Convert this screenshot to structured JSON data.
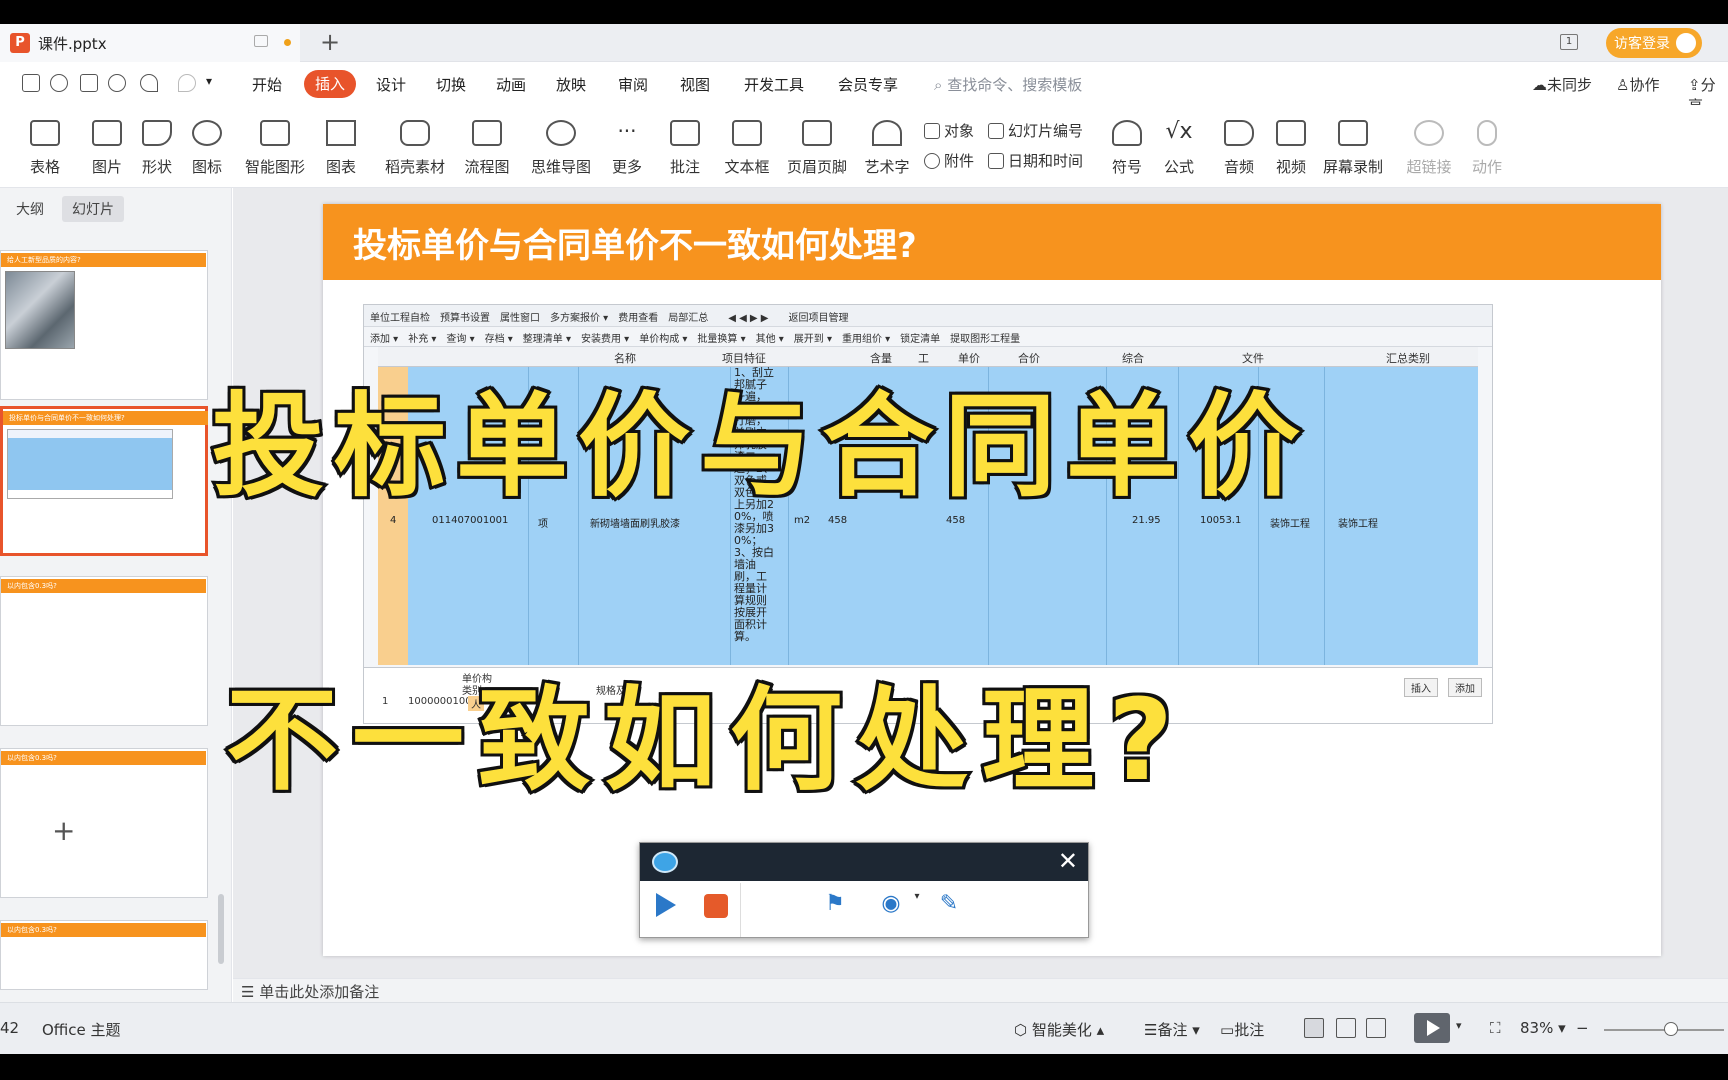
{
  "window": {
    "tab_title": "课件.pptx",
    "login_button": "访客登录",
    "new_tab": "+",
    "window_count": "1"
  },
  "menu": {
    "items": [
      "开始",
      "插入",
      "设计",
      "切换",
      "动画",
      "放映",
      "审阅",
      "视图",
      "开发工具",
      "会员专享"
    ],
    "active": "插入",
    "search_placeholder": "查找命令、搜索模板",
    "sync": "未同步",
    "collab": "协作",
    "share": "分享"
  },
  "ribbon": {
    "table": "表格",
    "picture": "图片",
    "shape": "形状",
    "icon": "图标",
    "smartart": "智能图形",
    "chart": "图表",
    "material": "稻壳素材",
    "flowchart": "流程图",
    "mindmap": "思维导图",
    "more": "更多",
    "comment": "批注",
    "textbox": "文本框",
    "header_footer": "页眉页脚",
    "wordart": "艺术字",
    "object": "对象",
    "slide_number": "幻灯片编号",
    "attachment": "附件",
    "datetime": "日期和时间",
    "symbol": "符号",
    "formula": "公式",
    "audio": "音频",
    "video": "视频",
    "screen_record": "屏幕录制",
    "hyperlink": "超链接",
    "action": "动作"
  },
  "left_pane": {
    "tab_outline": "大纲",
    "tab_slides": "幻灯片",
    "add": "+",
    "thumbs": [
      {
        "band": "给人工新型品质的内容?"
      },
      {
        "band": "投标单价与合同单价不一致如何处理?"
      },
      {
        "band": "以内包含0.3吗?"
      },
      {
        "band": "以内包含0.3吗?"
      },
      {
        "band": "以内包含0.3吗?"
      }
    ]
  },
  "slide": {
    "title": "投标单价与合同单价不一致如何处理?",
    "software": {
      "toolbar1": "单位工程自检　预算书设置　属性窗口　多方案报价 ▾　费用查看　局部汇总　　◀ ◀ ▶ ▶　　返回项目管理",
      "toolbar2": "添加 ▾　补充 ▾　查询 ▾　存档 ▾　整理清单 ▾　安装费用 ▾　单价构成 ▾　批量换算 ▾　其他 ▾　展开到 ▾　重用组价 ▾　锁定清单　提取图形工程量",
      "headers": [
        "名称",
        "项目特征",
        "含量",
        "工",
        "单价",
        "合价",
        "综合",
        "文件",
        "汇总类别"
      ],
      "row_num": "4",
      "row_code": "011407001001",
      "row_type": "项",
      "row_name": "新砌墙墙面刷乳胶漆",
      "row_unit": "m2",
      "row_qty1": "458",
      "row_qty2": "458",
      "row_price": "21.95",
      "row_total": "10053.1",
      "row_file1": "装饰工程",
      "row_file2": "装饰工程",
      "feature_text": "1、刮立邦腻子一遍，水砂纸打磨，羊刷立邦乳胶漆二遍；2、双色或双色以上另加20%，喷漆另加30%；3、按白墙油刷，工程量计算规则按展开面积计算。",
      "bottom_code": "1000000100",
      "bottom_num": "1",
      "bottom_type": "人",
      "bottom_hdr1": "类别",
      "bottom_hdr2": "规格及",
      "bottom_hdr3": "单价构",
      "btn_insert": "插入",
      "btn_add": "添加"
    }
  },
  "overlay": {
    "line1": "投标单价与合同单价",
    "line2": "不一致如何处理?"
  },
  "recorder": {
    "close": "✕"
  },
  "notes": {
    "placeholder": "单击此处添加备注"
  },
  "status": {
    "slide_num": "42",
    "theme": "Office 主题",
    "beautify": "智能美化",
    "notes": "备注",
    "comment": "批注",
    "zoom": "83%",
    "zoom_minus": "−"
  }
}
